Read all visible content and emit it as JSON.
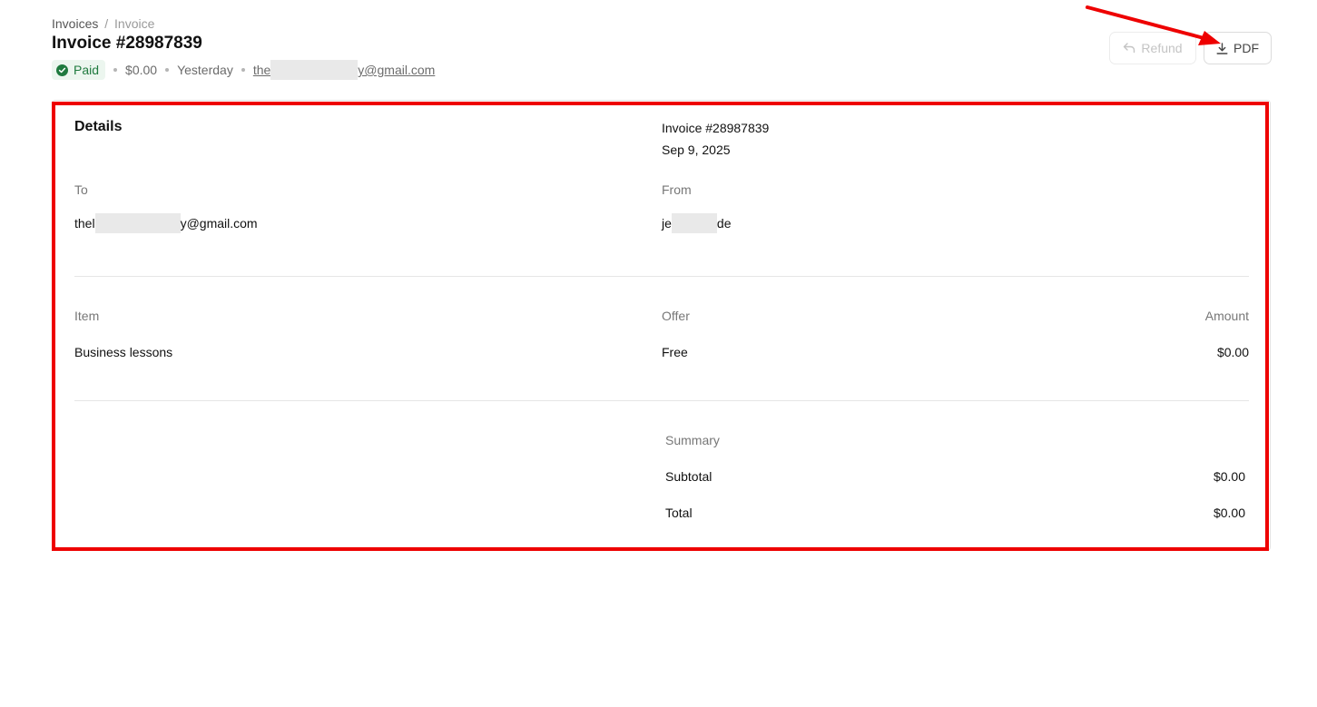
{
  "breadcrumb": {
    "parent": "Invoices",
    "separator": "/",
    "current": "Invoice"
  },
  "header": {
    "title": "Invoice #28987839",
    "status": "Paid",
    "amount": "$0.00",
    "date": "Yesterday",
    "email_prefix": "the",
    "email_suffix": "y@gmail.com"
  },
  "actions": {
    "refund_label": "Refund",
    "pdf_label": "PDF"
  },
  "details": {
    "title": "Details",
    "invoice_number": "Invoice #28987839",
    "invoice_date": "Sep 9, 2025",
    "to_label": "To",
    "to_prefix": "thel",
    "to_suffix": "y@gmail.com",
    "from_label": "From",
    "from_prefix": "je",
    "from_suffix": "de"
  },
  "items": {
    "columns": [
      "Item",
      "Offer",
      "Amount"
    ],
    "rows": [
      {
        "item": "Business lessons",
        "offer": "Free",
        "amount": "$0.00"
      }
    ]
  },
  "summary": {
    "title": "Summary",
    "subtotal_label": "Subtotal",
    "subtotal_value": "$0.00",
    "total_label": "Total",
    "total_value": "$0.00"
  },
  "colors": {
    "status_green": "#1f7a3f",
    "annotation_red": "#ee0000"
  }
}
